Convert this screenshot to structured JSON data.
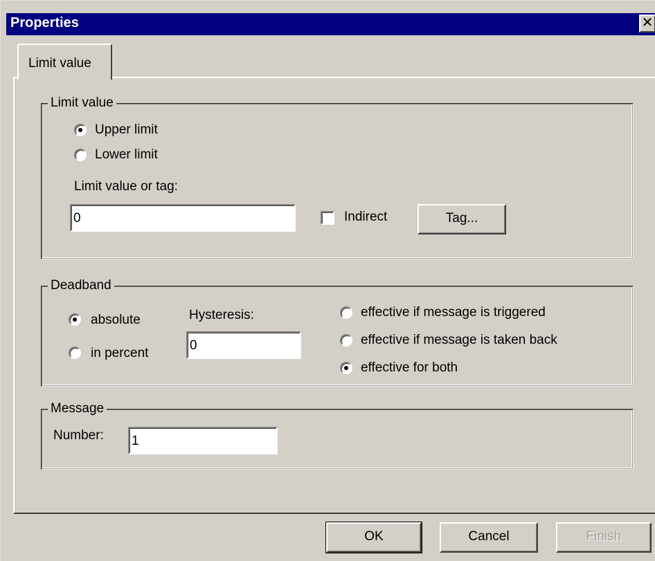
{
  "window": {
    "title": "Properties",
    "close_glyph": "✕"
  },
  "tabs": [
    {
      "label": "Limit value",
      "active": true
    }
  ],
  "limit_group": {
    "legend": "Limit value",
    "upper_label": "Upper limit",
    "lower_label": "Lower limit",
    "selected": "upper",
    "field_label": "Limit value or tag:",
    "field_value": "0",
    "indirect_label": "Indirect",
    "indirect_checked": false,
    "tag_button": "Tag..."
  },
  "deadband_group": {
    "legend": "Deadband",
    "absolute_label": "absolute",
    "percent_label": "in percent",
    "mode_selected": "absolute",
    "hysteresis_label": "Hysteresis:",
    "hysteresis_value": "0",
    "triggered_label": "effective if message is triggered",
    "taken_back_label": "effective if message is taken back",
    "both_label": "effective for both",
    "effect_selected": "both"
  },
  "message_group": {
    "legend": "Message",
    "number_label": "Number:",
    "number_value": "1"
  },
  "footer": {
    "ok": "OK",
    "cancel": "Cancel",
    "finish": "Finish"
  },
  "colors": {
    "face": "#d4d0c8",
    "title_bar": "#000080",
    "disabled_text": "#a0a0a0"
  }
}
